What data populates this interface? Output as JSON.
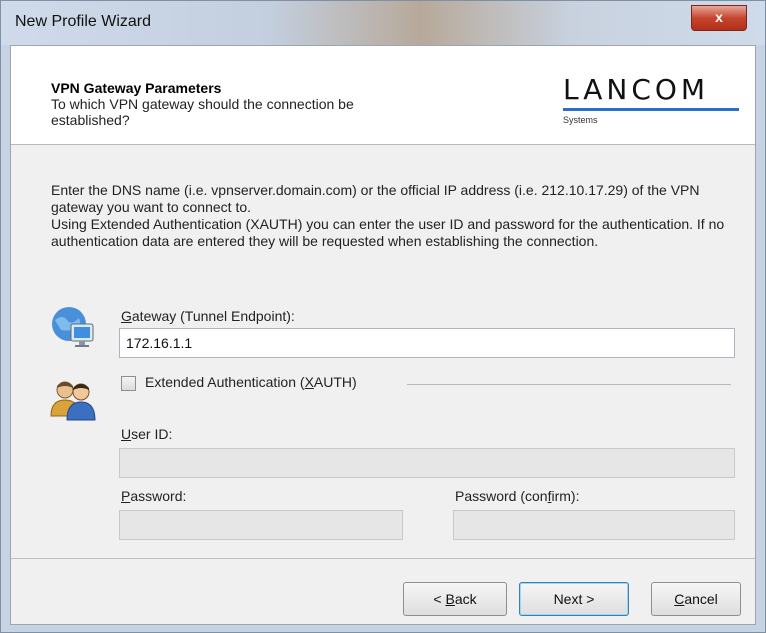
{
  "window": {
    "title": "New Profile Wizard",
    "close_glyph": "x"
  },
  "header": {
    "title": "VPN Gateway Parameters",
    "subtitle": "To which VPN gateway should the connection be established?",
    "logo_text": "LANCOM",
    "logo_sub": "Systems"
  },
  "intro": {
    "line1": "Enter the DNS name (i.e. vpnserver.domain.com) or the official IP address (i.e. 212.10.17.29) of the VPN gateway you want to connect to.",
    "line2": "Using Extended Authentication (XAUTH) you can enter the user ID and password for the authentication. If no authentication data are entered they will be requested when establishing the connection."
  },
  "gateway": {
    "label_prefix": "",
    "label_key": "G",
    "label_rest": "ateway (Tunnel Endpoint):",
    "value": "172.16.1.1",
    "icon": "network-computer-icon"
  },
  "xauth": {
    "label_prefix": "Extended Authentication (",
    "label_key": "X",
    "label_rest": "AUTH)",
    "checked": false,
    "icon": "users-icon"
  },
  "userid": {
    "label_key": "U",
    "label_rest": "ser ID:",
    "value": ""
  },
  "password": {
    "label_key": "P",
    "label_rest": "assword:",
    "value": ""
  },
  "password_confirm": {
    "label_prefix": "Password (con",
    "label_key": "f",
    "label_rest": "irm):",
    "value": ""
  },
  "buttons": {
    "back_prefix": "< ",
    "back_key": "B",
    "back_rest": "ack",
    "next": "Next >",
    "cancel_key": "C",
    "cancel_rest": "ancel"
  },
  "colors": {
    "logo_accent": "#2a6fc9",
    "close_button": "#c6452f"
  }
}
